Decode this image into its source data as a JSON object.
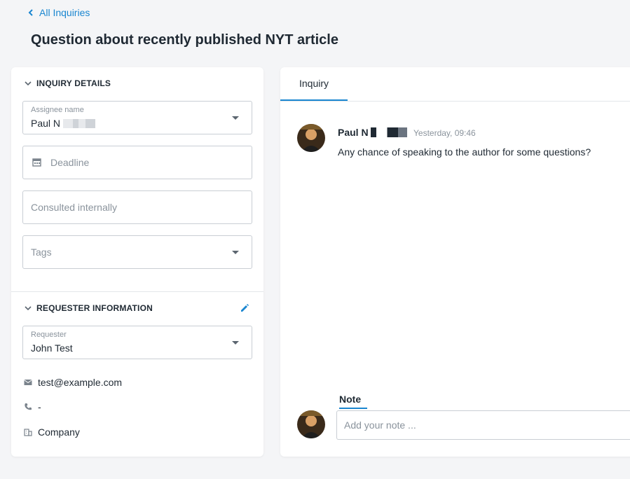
{
  "nav": {
    "back_label": "All Inquiries"
  },
  "page": {
    "title": "Question about recently published NYT article"
  },
  "inquiry_details": {
    "header": "INQUIRY DETAILS",
    "assignee": {
      "label": "Assignee name",
      "value": "Paul N"
    },
    "deadline": {
      "placeholder": "Deadline"
    },
    "consulted": {
      "placeholder": "Consulted internally"
    },
    "tags": {
      "placeholder": "Tags"
    }
  },
  "requester_info": {
    "header": "REQUESTER INFORMATION",
    "requester": {
      "label": "Requester",
      "value": "John Test"
    },
    "email": "test@example.com",
    "phone": "-",
    "company": "Company"
  },
  "conversation": {
    "tab_label": "Inquiry",
    "message": {
      "author": "Paul N",
      "time": "Yesterday, 09:46",
      "text": "Any chance of speaking to the author for some questions?"
    },
    "note": {
      "tab_label": "Note",
      "placeholder": "Add your note ..."
    }
  },
  "colors": {
    "accent": "#1a86d0",
    "text": "#1f2933",
    "muted": "#8a939c"
  }
}
